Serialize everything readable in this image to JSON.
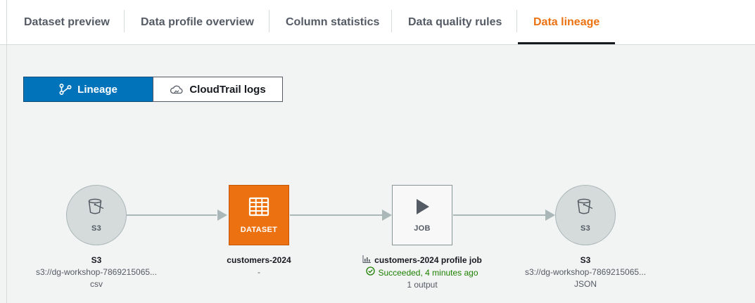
{
  "tabs": [
    {
      "label": "Dataset preview",
      "active": false
    },
    {
      "label": "Data profile overview",
      "active": false
    },
    {
      "label": "Column statistics",
      "active": false
    },
    {
      "label": "Data quality rules",
      "active": false
    },
    {
      "label": "Data lineage",
      "active": true
    }
  ],
  "view_toggle": {
    "lineage": {
      "label": "Lineage",
      "icon": "lineage-graph-icon",
      "selected": true
    },
    "cloudtrail": {
      "label": "CloudTrail logs",
      "icon": "cloud-icon",
      "selected": false
    }
  },
  "lineage": {
    "source": {
      "node_label": "S3",
      "icon": "bucket-icon",
      "title": "S3",
      "path": "s3://dg-workshop-7869215065...",
      "format": "csv"
    },
    "dataset": {
      "node_label": "DATASET",
      "icon": "table-icon",
      "title": "customers-2024",
      "detail": "-"
    },
    "job": {
      "node_label": "JOB",
      "icon": "play-icon",
      "title_icon": "profile-job-icon",
      "title": "customers-2024 profile job",
      "status": "Succeeded, 4 minutes ago",
      "status_icon": "check-circle-icon",
      "outputs": "1 output"
    },
    "target": {
      "node_label": "S3",
      "icon": "bucket-icon",
      "title": "S3",
      "path": "s3://dg-workshop-7869215065...",
      "format": "JSON"
    }
  },
  "colors": {
    "accent": "#ec7211",
    "selected": "#0073bb",
    "success": "#1d8102",
    "edge": "#aab7b8"
  }
}
